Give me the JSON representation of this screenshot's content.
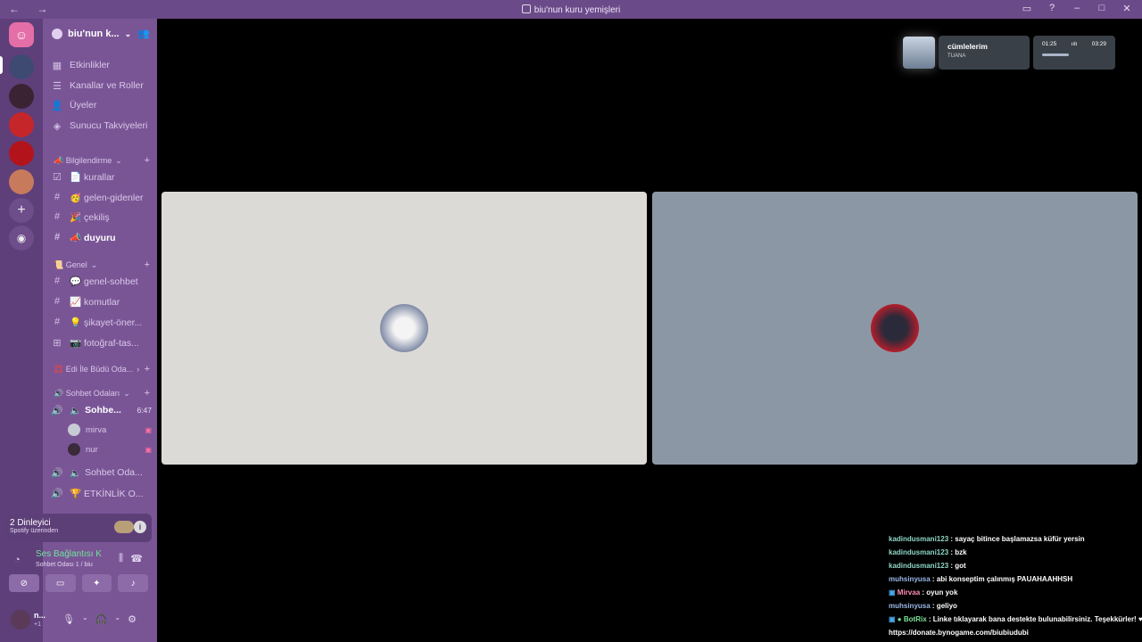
{
  "window": {
    "title": "biu'nun kuru yemişleri",
    "nav": "← →",
    "controls": [
      "inbox-icon",
      "help-icon",
      "minimize-icon",
      "maximize-icon",
      "close-icon"
    ]
  },
  "guild": {
    "name": "biu'nun k...",
    "top_items": [
      "Etkinlikler",
      "Kanallar ve Roller",
      "Üyeler",
      "Sunucu Takviyeleri"
    ],
    "categories": [
      {
        "name": "📣 Bilgilendirme",
        "channels": [
          "📄 kurallar",
          "🥳 gelen-gidenler",
          "🎉 çekiliş",
          "📣 duyuru"
        ]
      },
      {
        "name": "📜 Genel",
        "channels": [
          "💬 genel-sohbet",
          "📈 komutlar",
          "💡 şikayet-öner...",
          "📷 fotoğraf-tas..."
        ]
      },
      {
        "name": "💢 Edi İle Büdü Oda..."
      },
      {
        "name": "🔊 Sohbet Odaları"
      }
    ],
    "voice_active": {
      "name": "Sohbe...",
      "time": "6:47",
      "members": [
        "mirva",
        "nur"
      ]
    },
    "voice_others": [
      "Sohbet Oda...",
      "🏆 ETKİNLİK O..."
    ]
  },
  "panel": {
    "listeners": "2 Dinleyici",
    "listeners_sub": "Spotify üzerinden",
    "voice_status": "Ses Bağlantısı K",
    "voice_channel": "Sohbet Odası 1 / biu",
    "username": "n...",
    "user_status": "+1"
  },
  "now_playing": {
    "title": "cümlelerim",
    "artist": "TUANA",
    "elapsed": "01:25",
    "duration": "03:29",
    "progress": 0.41
  },
  "chat": [
    {
      "user": "kadindusmani123",
      "msg": ": sayaç bitince başlamazsa küfür yersin"
    },
    {
      "user": "kadindusmani123",
      "msg": ": bzk"
    },
    {
      "user": "kadindusmani123",
      "msg": ": got"
    },
    {
      "user": "muhsinyusa",
      "msg": ": abi konseptim çalınmış PAUAHAAHHSH"
    },
    {
      "user": "Mirvaa",
      "msg": ": oyun yok"
    },
    {
      "user": "muhsinyusa",
      "msg": ": geliyo"
    },
    {
      "user": "BotRix",
      "msg": ": Linke tıklayarak bana destekte bulunabilirsiniz. Teşekkürler! ♥"
    },
    {
      "user": "",
      "msg": "https://donate.bynogame.com/biubiudubi"
    }
  ],
  "colors": {
    "accent": "#7a5596",
    "tile_left": "#dcdad6",
    "tile_right": "#8c97a6"
  }
}
